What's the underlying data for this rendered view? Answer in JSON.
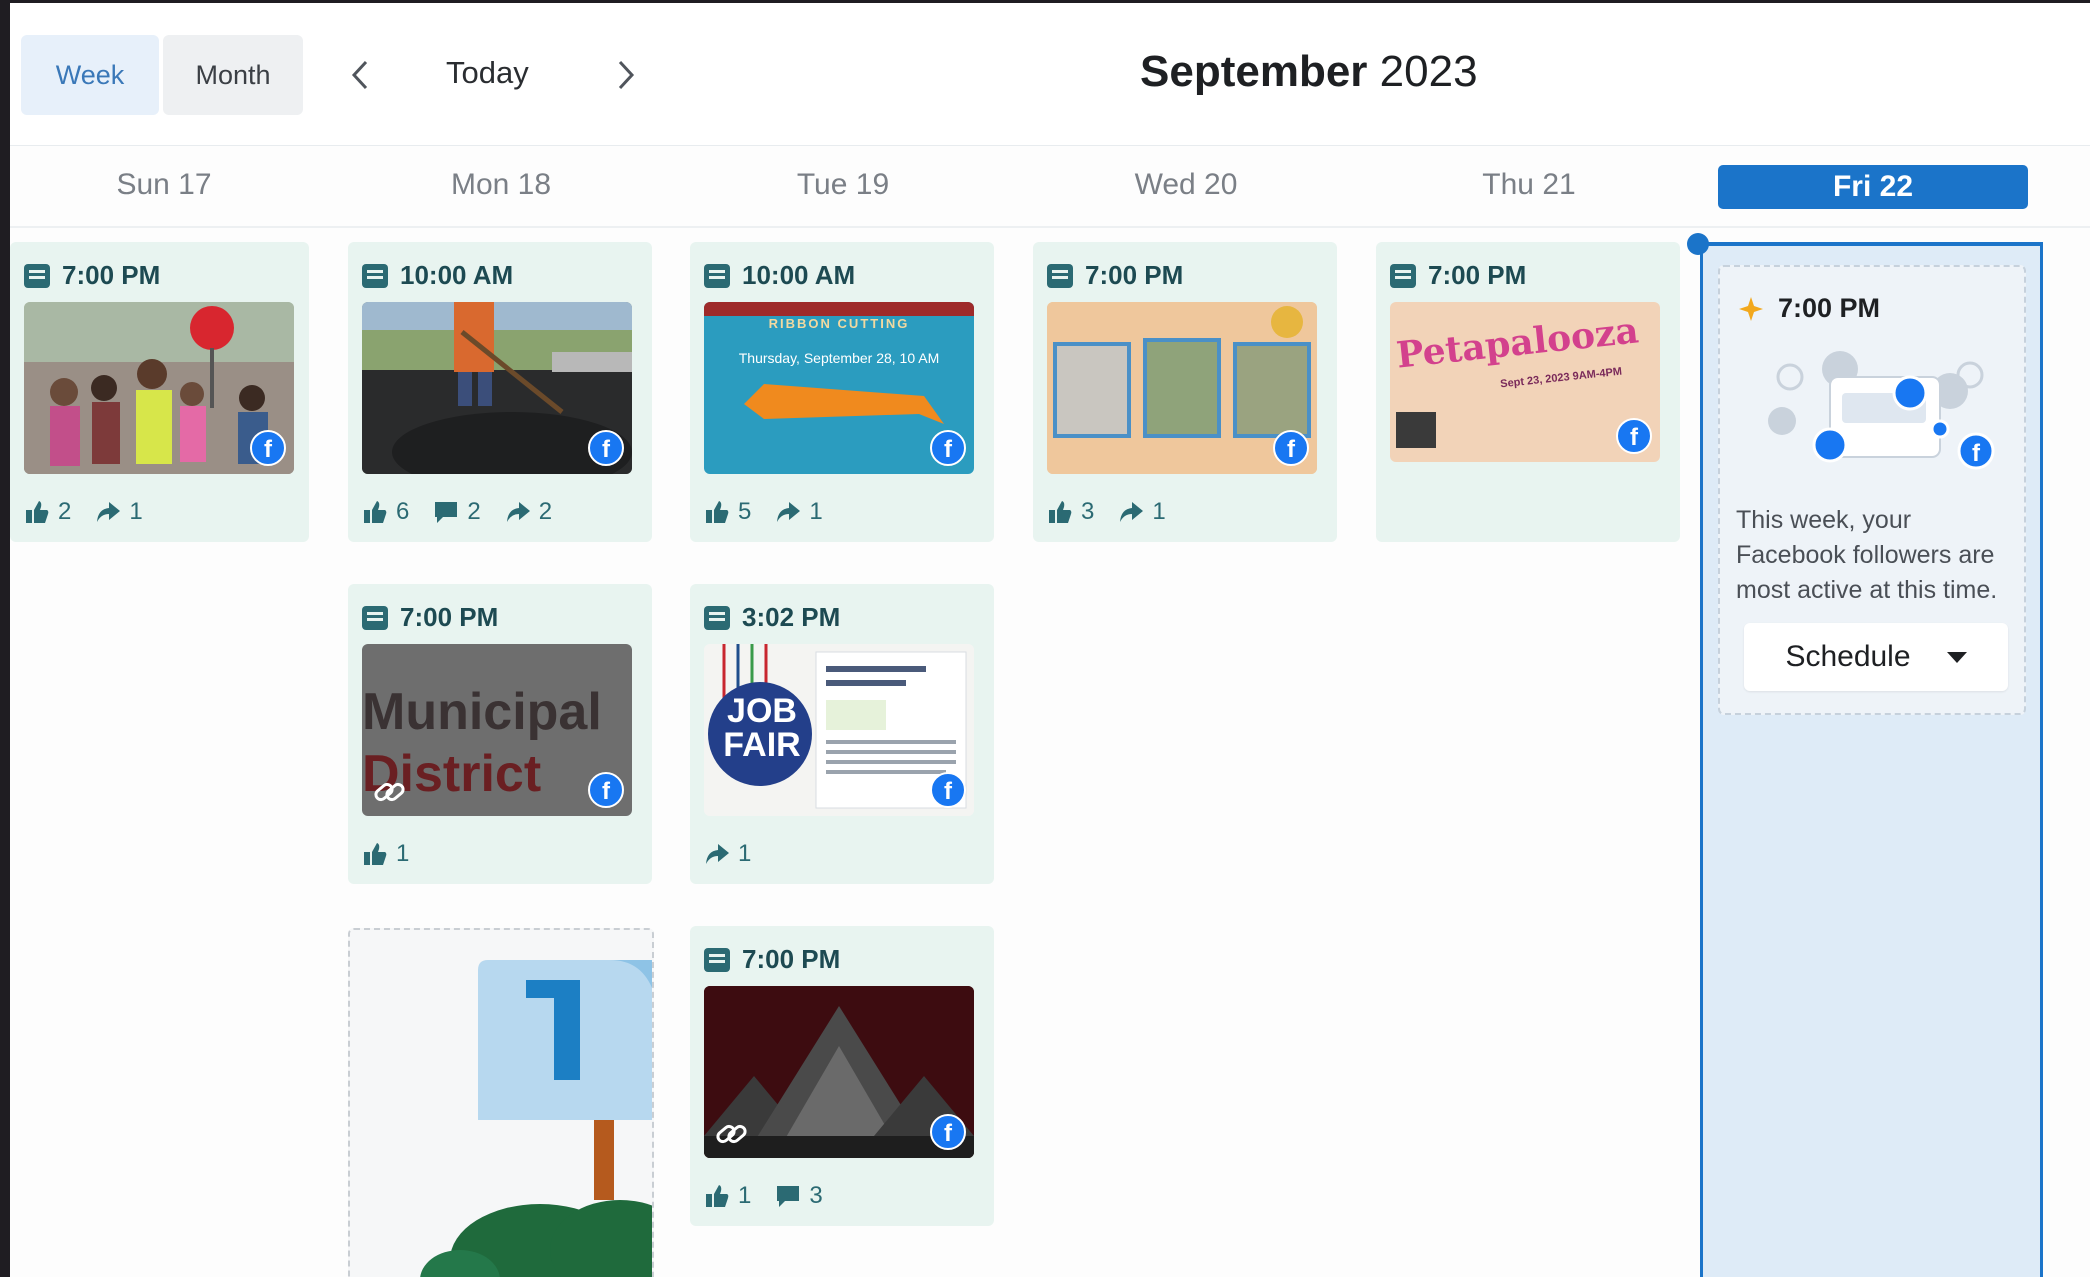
{
  "toolbar": {
    "week_label": "Week",
    "month_label": "Month",
    "today_label": "Today",
    "title_month": "September",
    "title_year": "2023"
  },
  "days": [
    "Sun 17",
    "Mon 18",
    "Tue 19",
    "Wed 20",
    "Thu 21",
    "Fri 22"
  ],
  "active_day_index": 5,
  "posts": {
    "sun_1": {
      "time": "7:00 PM",
      "likes": "2",
      "shares": "1"
    },
    "mon_1": {
      "time": "10:00 AM",
      "likes": "6",
      "comments": "2",
      "shares": "2"
    },
    "tue_1": {
      "time": "10:00 AM",
      "likes": "5",
      "shares": "1",
      "img_banner": "RIBBON CUTTING",
      "img_date": "Thursday, September 28, 10 AM"
    },
    "wed_1": {
      "time": "7:00 PM",
      "likes": "3",
      "shares": "1"
    },
    "thu_1": {
      "time": "7:00 PM",
      "img_title": "Petapalooza",
      "img_sub": "Sept 23, 2023 9AM-4PM"
    },
    "mon_2": {
      "time": "7:00 PM",
      "likes": "1",
      "img_line1": "Municipal",
      "img_line2": "District"
    },
    "tue_2": {
      "time": "3:02 PM",
      "shares": "1",
      "img_line1": "JOB",
      "img_line2": "FAIR"
    },
    "tue_3": {
      "time": "7:00 PM",
      "likes": "1",
      "comments": "3"
    }
  },
  "suggestion": {
    "time": "7:00 PM",
    "text": "This week, your Facebook followers are most active at this time.",
    "button_label": "Schedule"
  },
  "colors": {
    "accent": "#1b74c9",
    "card_bg": "#e8f4f0",
    "facebook": "#1877f2",
    "stat": "#2b6a73"
  }
}
